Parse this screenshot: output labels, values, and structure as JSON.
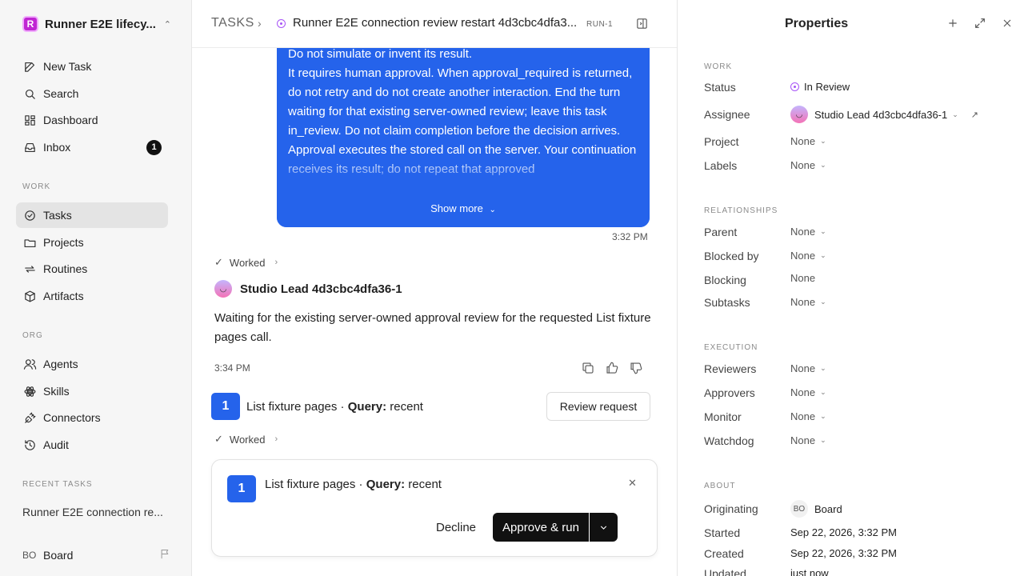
{
  "workspace": {
    "logo_letter": "R",
    "name": "Runner E2E lifecy..."
  },
  "nav": {
    "new_task": "New Task",
    "search": "Search",
    "dashboard": "Dashboard",
    "inbox": "Inbox",
    "inbox_count": "1"
  },
  "sections": {
    "work": "WORK",
    "org": "ORG",
    "recent": "RECENT TASKS"
  },
  "work_items": {
    "tasks": "Tasks",
    "projects": "Projects",
    "routines": "Routines",
    "artifacts": "Artifacts"
  },
  "org_items": {
    "agents": "Agents",
    "skills": "Skills",
    "connectors": "Connectors",
    "audit": "Audit"
  },
  "recent_tasks": [
    "Runner E2E connection re..."
  ],
  "user": {
    "initials": "BO",
    "name": "Board"
  },
  "breadcrumb": {
    "root": "TASKS",
    "title": "Runner E2E connection review restart 4d3cbc4dfa3...",
    "id": "RUN-1"
  },
  "user_message": {
    "lines": [
      "Do not simulate or invent its result.",
      "It requires human approval. When approval_required is returned, do not retry and do not create another interaction. End the turn waiting for that existing server-owned review; leave this task in_review. Do not claim completion before the decision arrives.",
      "Approval executes the stored call on the server. Your continuation receives its result; do not repeat that approved"
    ],
    "show_more": "Show more",
    "time": "3:32 PM"
  },
  "worked_label": "Worked",
  "agent_reply": {
    "name": "Studio Lead 4d3cbc4dfa36-1",
    "text": "Waiting for the existing server-owned approval review for the requested List fixture pages call.",
    "time": "3:34 PM"
  },
  "request": {
    "number": "1",
    "text": "List fixture pages · ",
    "query_label": "Query:",
    "query_value": " recent",
    "review_button": "Review request"
  },
  "approval": {
    "number": "1",
    "text": "List fixture pages · ",
    "query_label": "Query:",
    "query_value": " recent",
    "decline": "Decline",
    "approve": "Approve & run"
  },
  "properties": {
    "title": "Properties",
    "work_section": "WORK",
    "status_label": "Status",
    "status_value": "In Review",
    "assignee_label": "Assignee",
    "assignee_value": "Studio Lead 4d3cbc4dfa36-1",
    "project_label": "Project",
    "project_value": "None",
    "labels_label": "Labels",
    "labels_value": "None",
    "relationships_section": "RELATIONSHIPS",
    "parent_label": "Parent",
    "parent_value": "None",
    "blocked_by_label": "Blocked by",
    "blocked_by_value": "None",
    "blocking_label": "Blocking",
    "blocking_value": "None",
    "subtasks_label": "Subtasks",
    "subtasks_value": "None",
    "execution_section": "EXECUTION",
    "reviewers_label": "Reviewers",
    "reviewers_value": "None",
    "approvers_label": "Approvers",
    "approvers_value": "None",
    "monitor_label": "Monitor",
    "monitor_value": "None",
    "watchdog_label": "Watchdog",
    "watchdog_value": "None",
    "about_section": "ABOUT",
    "originating_label": "Originating",
    "originating_initials": "BO",
    "originating_value": "Board",
    "started_label": "Started",
    "started_value": "Sep 22, 2026, 3:32 PM",
    "created_label": "Created",
    "created_value": "Sep 22, 2026, 3:32 PM",
    "updated_label": "Updated",
    "updated_value": "just now"
  },
  "colors": {
    "accent_blue": "#2563eb",
    "status_purple": "#a855f7",
    "workspace_logo": "#c026d3"
  }
}
